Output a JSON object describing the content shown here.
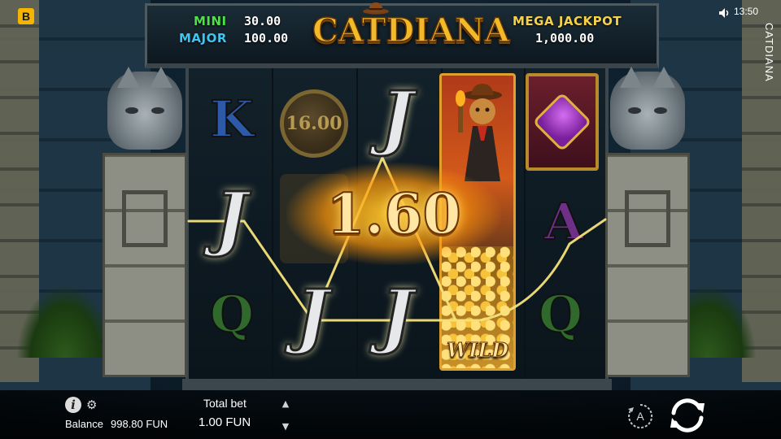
{
  "status_bar": {
    "brand_icon_letter": "B",
    "sound_icon": "speaker-icon",
    "time": "13:50",
    "game_name_vertical": "CATDIANA"
  },
  "header": {
    "logo_text": "CATDIANA",
    "mini_label": "MINI",
    "mini_value": "30.00",
    "major_label": "MAJOR",
    "major_value": "100.00",
    "mega_label": "MEGA JACKPOT",
    "mega_value": "1,000.00"
  },
  "reels": {
    "symbols": {
      "k": "K",
      "q": "Q",
      "a": "A",
      "j": "J",
      "coin_value": "16.00",
      "wild_label": "WILD",
      "gem_icon": "heart-gem-icon"
    },
    "win_value": "1.60"
  },
  "bottom_bar": {
    "info_icon": "info-icon",
    "settings_icon": "gear-icon",
    "balance_label": "Balance",
    "balance_value": "998.80 FUN",
    "total_bet_label": "Total bet",
    "total_bet_value": "1.00 FUN",
    "bet_up_icon": "triangle-up-icon",
    "bet_down_icon": "triangle-down-icon",
    "autoplay_letter": "A",
    "spin_icon": "refresh-icon"
  },
  "colors": {
    "mini": "#4fe04a",
    "major": "#3ec6f2",
    "mega": "#f6d24a",
    "win_line": "#f6e27a",
    "logo": "#f2b929"
  }
}
